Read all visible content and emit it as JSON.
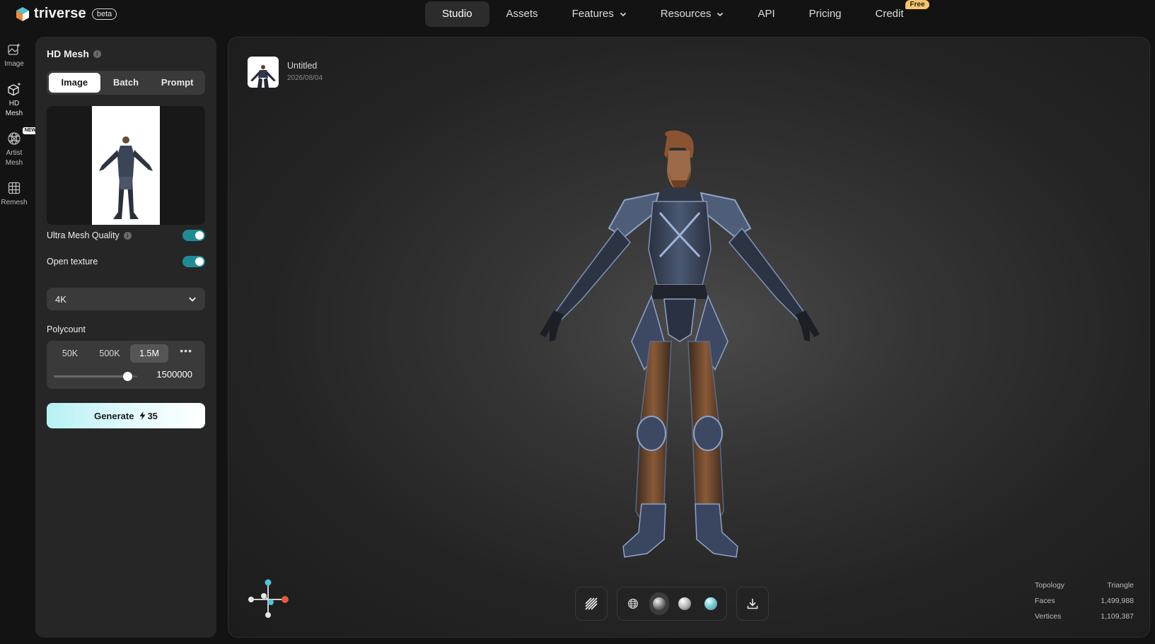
{
  "brand": {
    "name": "triverse",
    "badge": "beta"
  },
  "nav": {
    "items": [
      {
        "label": "Studio",
        "active": true,
        "dropdown": false
      },
      {
        "label": "Assets",
        "active": false,
        "dropdown": false
      },
      {
        "label": "Features",
        "active": false,
        "dropdown": true
      },
      {
        "label": "Resources",
        "active": false,
        "dropdown": true
      },
      {
        "label": "API",
        "active": false,
        "dropdown": false
      },
      {
        "label": "Pricing",
        "active": false,
        "dropdown": false
      },
      {
        "label": "Credit",
        "active": false,
        "dropdown": false,
        "badge": "Free"
      }
    ]
  },
  "rail": {
    "items": [
      {
        "label": "Image",
        "icon": "image-sparkle-icon",
        "active": false
      },
      {
        "label": "HD Mesh",
        "icon": "cube-sparkle-icon",
        "active": true
      },
      {
        "label": "Artist Mesh",
        "icon": "wire-sphere-icon",
        "active": false,
        "badge": "NEW"
      },
      {
        "label": "Remesh",
        "icon": "grid-icon",
        "active": false
      }
    ]
  },
  "panel": {
    "title": "HD Mesh",
    "tabs": [
      {
        "label": "Image",
        "active": true
      },
      {
        "label": "Batch",
        "active": false
      },
      {
        "label": "Prompt",
        "active": false
      }
    ],
    "ultra_quality": {
      "label": "Ultra Mesh Quality",
      "on": true
    },
    "open_texture": {
      "label": "Open texture",
      "on": true
    },
    "texture_resolution": "4K",
    "polycount": {
      "label": "Polycount",
      "options": [
        {
          "label": "50K",
          "active": false
        },
        {
          "label": "500K",
          "active": false
        },
        {
          "label": "1.5M",
          "active": true
        }
      ],
      "value": "1500000",
      "slider_fraction": 0.88
    },
    "generate": {
      "label": "Generate",
      "cost": "35"
    }
  },
  "viewer": {
    "asset": {
      "name": "Untitled",
      "date": "2026/08/04"
    },
    "stats": [
      {
        "label": "Topology",
        "value": "Triangle"
      },
      {
        "label": "Faces",
        "value": "1,499,988"
      },
      {
        "label": "Vertices",
        "value": "1,109,387"
      }
    ],
    "accent_colors": {
      "toggle": "#1f8c93",
      "axis_y": "#4fc3d8",
      "axis_x": "#e8573c"
    }
  }
}
